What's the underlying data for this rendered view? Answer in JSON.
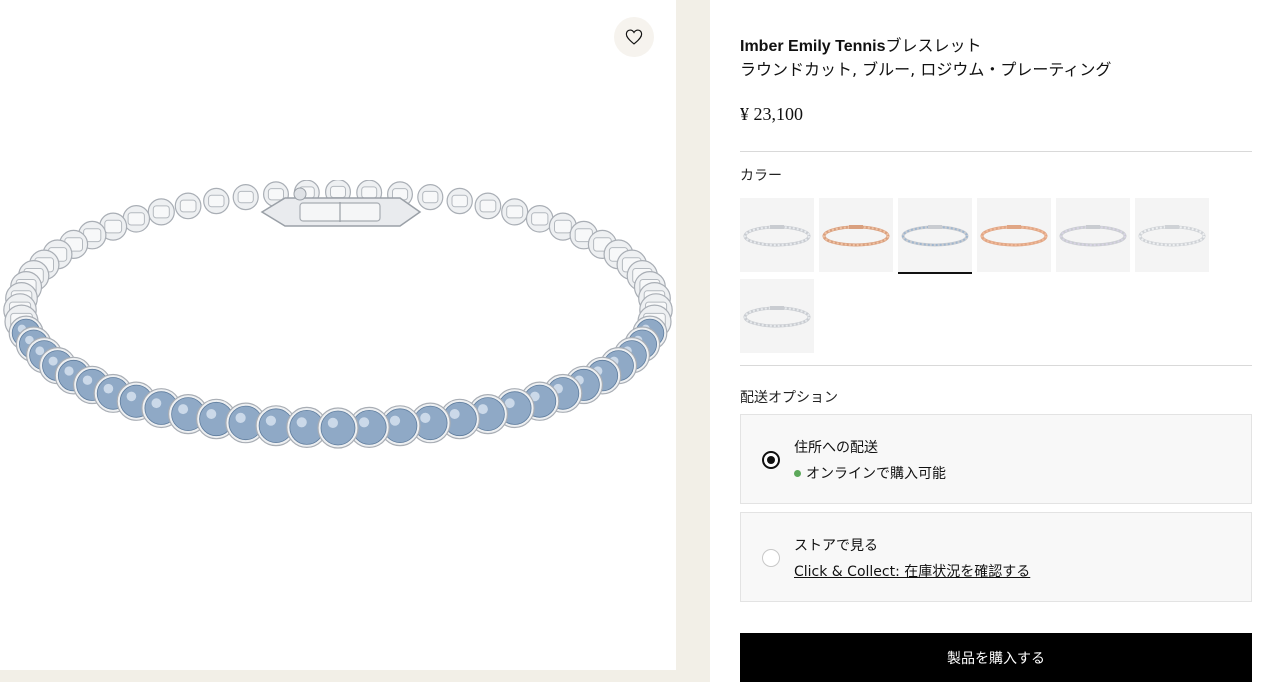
{
  "product": {
    "title_bold": "Imber Emily Tennis",
    "title_rest": "ブレスレット",
    "subtitle": "ラウンドカット, ブルー, ロジウム・プレーティング",
    "price": "¥ 23,100"
  },
  "gallery": {
    "wishlist_icon": "heart-icon",
    "image_name": "bracelet-product-image"
  },
  "colors": {
    "label": "カラー",
    "selected_index": 2,
    "swatches": [
      {
        "name": "silver-clear",
        "metal": "#c9ccd1",
        "stone": "#e8ebef"
      },
      {
        "name": "rose-gold-peach",
        "metal": "#d9a07f",
        "stone": "#f0c2a3"
      },
      {
        "name": "silver-blue",
        "metal": "#c9ccd1",
        "stone": "#9fb6cf"
      },
      {
        "name": "rose-gold",
        "metal": "#e0a685",
        "stone": "#f1b999"
      },
      {
        "name": "silver-lilac",
        "metal": "#c9ccd1",
        "stone": "#d8d4e4"
      },
      {
        "name": "silver-white",
        "metal": "#cfd2d6",
        "stone": "#eef0f2"
      },
      {
        "name": "silver-clear-2",
        "metal": "#c9ccd1",
        "stone": "#e6e9ec"
      }
    ]
  },
  "delivery": {
    "label": "配送オプション",
    "options": [
      {
        "title": "住所への配送",
        "status": "オンラインで購入可能",
        "selected": true
      },
      {
        "title": "ストアで見る",
        "link": "Click & Collect: 在庫状況を確認する",
        "selected": false
      }
    ]
  },
  "buy_button": "製品を購入する",
  "theme": {
    "gallery_bg": "#f2efe7",
    "button_bg": "#000000",
    "available_green": "#5ca85a",
    "stone_blue": "#8fa9c6"
  }
}
